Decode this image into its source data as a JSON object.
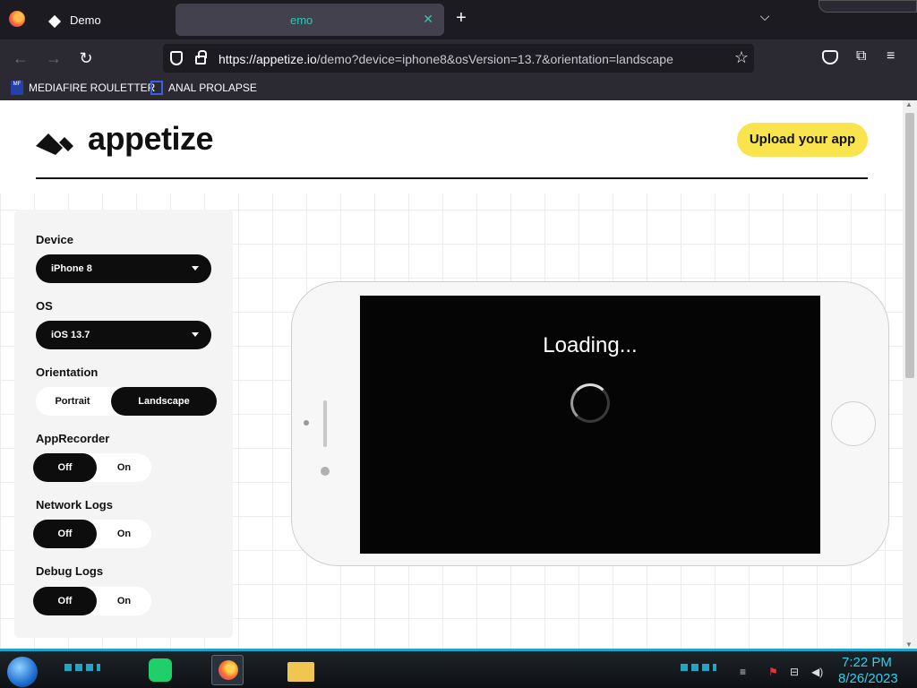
{
  "browser": {
    "tabs": [
      {
        "label": "Demo"
      },
      {
        "label": "emo"
      }
    ],
    "url": {
      "host": "https://appetize.io",
      "path": "/demo?device=iphone8&osVersion=13.7&orientation=landscape"
    },
    "bookmarks": [
      {
        "label": "MEDIAFIRE ROULETTER",
        "icon": "MF"
      },
      {
        "label": "ANAL PROLAPSE"
      }
    ],
    "icons": {
      "close": "✕",
      "new_tab": "+",
      "tab_list": "⌵",
      "back": "←",
      "forward": "→",
      "reload": "↻",
      "star": "☆",
      "extensions": "⧉",
      "menu": "≡"
    }
  },
  "page": {
    "logo_text": "appetize",
    "upload_button": "Upload your app",
    "settings": {
      "device_label": "Device",
      "device_value": "iPhone 8",
      "os_label": "OS",
      "os_value": "iOS 13.7",
      "orientation_label": "Orientation",
      "orientation_options": [
        "Portrait",
        "Landscape"
      ],
      "orientation_selected": "Landscape",
      "app_recorder_label": "AppRecorder",
      "network_logs_label": "Network Logs",
      "debug_logs_label": "Debug Logs",
      "toggle_off": "Off",
      "toggle_on": "On",
      "app_recorder_selected": "Off",
      "network_logs_selected": "Off",
      "debug_logs_selected": "Off"
    },
    "device_screen": {
      "loading_text": "Loading..."
    },
    "brand_colors": {
      "accent_yellow": "#f9e44d",
      "black": "#0d0d0d"
    }
  },
  "taskbar": {
    "time": "7:22 PM",
    "date": "8/26/2023",
    "accent": "#2bd1f0"
  }
}
